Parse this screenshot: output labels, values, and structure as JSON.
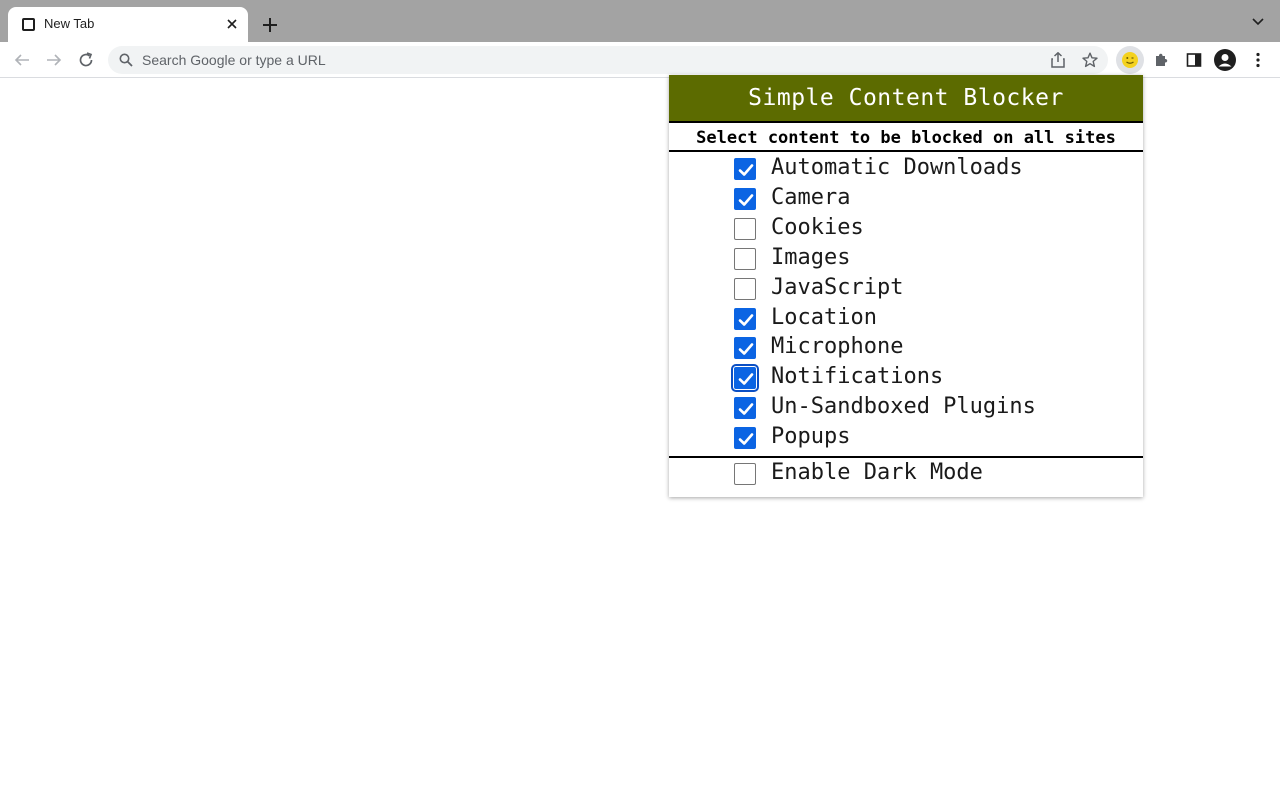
{
  "browser": {
    "tab": {
      "title": "New Tab"
    },
    "omnibox": {
      "placeholder": "Search Google or type a URL"
    }
  },
  "popup": {
    "title": "Simple Content Blocker",
    "subtitle": "Select content to be blocked on all sites",
    "options": [
      {
        "label": "Automatic Downloads",
        "checked": true
      },
      {
        "label": "Camera",
        "checked": true
      },
      {
        "label": "Cookies",
        "checked": false
      },
      {
        "label": "Images",
        "checked": false
      },
      {
        "label": "JavaScript",
        "checked": false
      },
      {
        "label": "Location",
        "checked": true
      },
      {
        "label": "Microphone",
        "checked": true
      },
      {
        "label": "Notifications",
        "checked": true,
        "focused": true
      },
      {
        "label": "Un-Sandboxed Plugins",
        "checked": true
      },
      {
        "label": "Popups",
        "checked": true
      }
    ],
    "dark_mode": {
      "label": "Enable Dark Mode",
      "checked": false
    }
  },
  "colors": {
    "header_bg": "#5c6b00",
    "checkbox_checked": "#0b64e3",
    "tabstrip_bg": "#a3a3a3"
  },
  "icons": {
    "extension": "smiley-face-icon",
    "extensions_menu": "puzzle-icon",
    "side_panel": "side-panel-icon",
    "profile": "profile-avatar-icon",
    "menu": "kebab-menu-icon"
  }
}
